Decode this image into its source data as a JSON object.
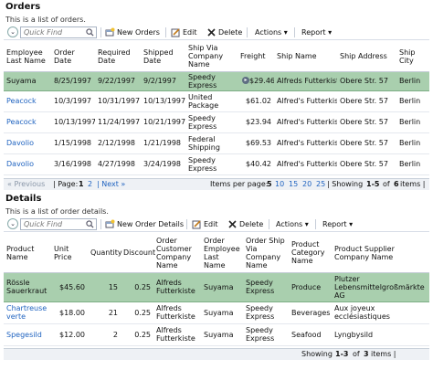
{
  "orders": {
    "title": "Orders",
    "description": "This is a list of orders.",
    "toolbar": {
      "quick_find_placeholder": "Quick Find",
      "new_label": "New Orders",
      "edit_label": "Edit",
      "delete_label": "Delete",
      "actions_label": "Actions",
      "report_label": "Report"
    },
    "columns": [
      "Employee Last Name",
      "Order Date",
      "Required Date",
      "Shipped Date",
      "Ship Via Company Name",
      "Freight",
      "Ship Name",
      "Ship Address",
      "Ship City"
    ],
    "rows": [
      {
        "employee": "Suyama",
        "order_date": "8/25/1997",
        "required_date": "9/22/1997",
        "shipped_date": "9/2/1997",
        "ship_via": "Speedy Express",
        "freight": "$29.46",
        "ship_name": "Alfreds Futterkiste",
        "ship_address": "Obere Str. 57",
        "ship_city": "Berlin",
        "selected": true
      },
      {
        "employee": "Peacock",
        "order_date": "10/3/1997",
        "required_date": "10/31/1997",
        "shipped_date": "10/13/1997",
        "ship_via": "United Package",
        "freight": "$61.02",
        "ship_name": "Alfred's Futterkiste",
        "ship_address": "Obere Str. 57",
        "ship_city": "Berlin",
        "selected": false
      },
      {
        "employee": "Peacock",
        "order_date": "10/13/1997",
        "required_date": "11/24/1997",
        "shipped_date": "10/21/1997",
        "ship_via": "Speedy Express",
        "freight": "$23.94",
        "ship_name": "Alfred's Futterkiste",
        "ship_address": "Obere Str. 57",
        "ship_city": "Berlin",
        "selected": false
      },
      {
        "employee": "Davolio",
        "order_date": "1/15/1998",
        "required_date": "2/12/1998",
        "shipped_date": "1/21/1998",
        "ship_via": "Federal Shipping",
        "freight": "$69.53",
        "ship_name": "Alfred's Futterkiste",
        "ship_address": "Obere Str. 57",
        "ship_city": "Berlin",
        "selected": false
      },
      {
        "employee": "Davolio",
        "order_date": "3/16/1998",
        "required_date": "4/27/1998",
        "shipped_date": "3/24/1998",
        "ship_via": "Speedy Express",
        "freight": "$40.42",
        "ship_name": "Alfred's Futterkiste",
        "ship_address": "Obere Str. 57",
        "ship_city": "Berlin",
        "selected": false
      }
    ],
    "pager": {
      "previous": "« Previous",
      "page_label": "| Page:",
      "pages": [
        "1",
        "2"
      ],
      "next": "| Next »",
      "items_per_page_label": "Items per page:",
      "sizes": [
        "5",
        "10",
        "15",
        "20",
        "25"
      ],
      "showing_prefix": "| Showing",
      "showing_range": "1-5",
      "showing_of": "of",
      "showing_total": "6",
      "showing_suffix": "items |"
    }
  },
  "details": {
    "title": "Details",
    "description": "This is a list of order details.",
    "toolbar": {
      "quick_find_placeholder": "Quick Find",
      "new_label": "New Order Details",
      "edit_label": "Edit",
      "delete_label": "Delete",
      "actions_label": "Actions",
      "report_label": "Report"
    },
    "columns": [
      "Product Name",
      "Unit Price",
      "Quantity",
      "Discount",
      "Order Customer Company Name",
      "Order Employee Last Name",
      "Order Ship Via Company Name",
      "Product Category Name",
      "Product Supplier Company Name"
    ],
    "rows": [
      {
        "product": "Rössle Sauerkraut",
        "unit_price": "$45.60",
        "quantity": "15",
        "discount": "0.25",
        "customer": "Alfreds Futterkiste",
        "employee": "Suyama",
        "ship_via": "Speedy Express",
        "category": "Produce",
        "supplier": "Plutzer Lebensmittelgroßmärkte AG",
        "selected": true
      },
      {
        "product": "Chartreuse verte",
        "unit_price": "$18.00",
        "quantity": "21",
        "discount": "0.25",
        "customer": "Alfreds Futterkiste",
        "employee": "Suyama",
        "ship_via": "Speedy Express",
        "category": "Beverages",
        "supplier": "Aux joyeux ecclésiastiques",
        "selected": false
      },
      {
        "product": "Spegesild",
        "unit_price": "$12.00",
        "quantity": "2",
        "discount": "0.25",
        "customer": "Alfreds Futterkiste",
        "employee": "Suyama",
        "ship_via": "Speedy Express",
        "category": "Seafood",
        "supplier": "Lyngbysild",
        "selected": false
      }
    ],
    "pager": {
      "showing_prefix": "Showing",
      "showing_range": "1-3",
      "showing_of": "of",
      "showing_total": "3",
      "showing_suffix": "items |"
    }
  },
  "colors": {
    "link": "#1f63c0",
    "selected_row": "#a9cfae",
    "pager_bg": "#eef1f5"
  }
}
